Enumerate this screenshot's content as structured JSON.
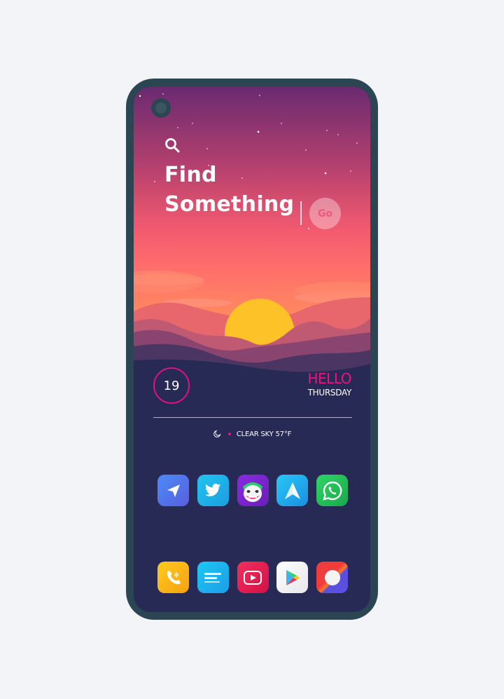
{
  "search": {
    "line1": "Find",
    "line2": "Something",
    "go_label": "Go"
  },
  "widget": {
    "date": "19",
    "greeting": "HELLO",
    "weekday": "THURSDAY",
    "weather": "CLEAR SKY 57°F"
  },
  "apps": {
    "row1": [
      "telegram-icon",
      "twitter-icon",
      "joker-app-icon",
      "send-arrow-icon",
      "whatsapp-icon"
    ],
    "row2": [
      "phone-icon",
      "messages-icon",
      "youtube-icon",
      "play-store-icon",
      "chrome-icon"
    ]
  },
  "colors": {
    "accent": "#f0127f",
    "phone_frame": "#2b4553",
    "screen_bg": "#272a55",
    "page_bg": "#f2f4f8"
  }
}
